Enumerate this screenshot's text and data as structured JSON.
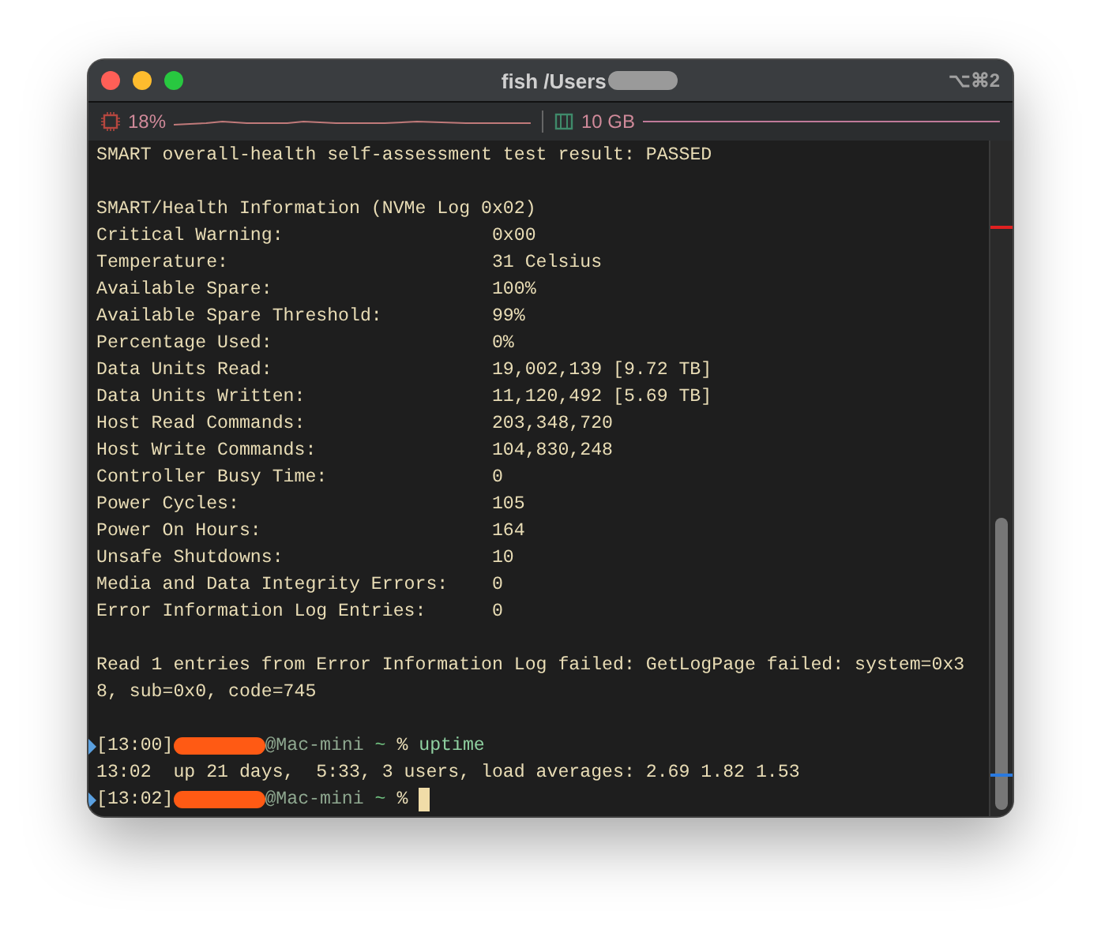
{
  "window": {
    "title": "fish /Users",
    "shortcut": "⌥⌘2"
  },
  "status_bar": {
    "cpu": {
      "reading": "18%"
    },
    "memory": {
      "reading": "10 GB"
    }
  },
  "terminal": {
    "lines": [
      {
        "kind": "text",
        "text": "SMART overall-health self-assessment test result: PASSED"
      },
      {
        "kind": "blank"
      },
      {
        "kind": "text",
        "text": "SMART/Health Information (NVMe Log 0x02)"
      },
      {
        "kind": "pair",
        "name": "Critical Warning:",
        "value": "0x00"
      },
      {
        "kind": "pair",
        "name": "Temperature:",
        "value": "31 Celsius"
      },
      {
        "kind": "pair",
        "name": "Available Spare:",
        "value": "100%"
      },
      {
        "kind": "pair",
        "name": "Available Spare Threshold:",
        "value": "99%"
      },
      {
        "kind": "pair",
        "name": "Percentage Used:",
        "value": "0%"
      },
      {
        "kind": "pair",
        "name": "Data Units Read:",
        "value": "19,002,139 [9.72 TB]"
      },
      {
        "kind": "pair",
        "name": "Data Units Written:",
        "value": "11,120,492 [5.69 TB]"
      },
      {
        "kind": "pair",
        "name": "Host Read Commands:",
        "value": "203,348,720"
      },
      {
        "kind": "pair",
        "name": "Host Write Commands:",
        "value": "104,830,248"
      },
      {
        "kind": "pair",
        "name": "Controller Busy Time:",
        "value": "0"
      },
      {
        "kind": "pair",
        "name": "Power Cycles:",
        "value": "105"
      },
      {
        "kind": "pair",
        "name": "Power On Hours:",
        "value": "164"
      },
      {
        "kind": "pair",
        "name": "Unsafe Shutdowns:",
        "value": "10"
      },
      {
        "kind": "pair",
        "name": "Media and Data Integrity Errors:",
        "value": "0"
      },
      {
        "kind": "pair",
        "name": "Error Information Log Entries:",
        "value": "0"
      },
      {
        "kind": "blank"
      },
      {
        "kind": "text",
        "text": "Read 1 entries from Error Information Log failed: GetLogPage failed: system=0x38, sub=0x0, code=745"
      },
      {
        "kind": "blank"
      },
      {
        "kind": "prompt",
        "time": "[13:00]",
        "host": "@Mac-mini",
        "dir": "~",
        "symbol": "%",
        "command": "uptime",
        "cursor": false
      },
      {
        "kind": "text",
        "text": "13:02  up 21 days,  5:33, 3 users, load averages: 2.69 1.82 1.53"
      },
      {
        "kind": "prompt",
        "time": "[13:02]",
        "host": "@Mac-mini",
        "dir": "~",
        "symbol": "%",
        "cursor": true
      }
    ]
  }
}
